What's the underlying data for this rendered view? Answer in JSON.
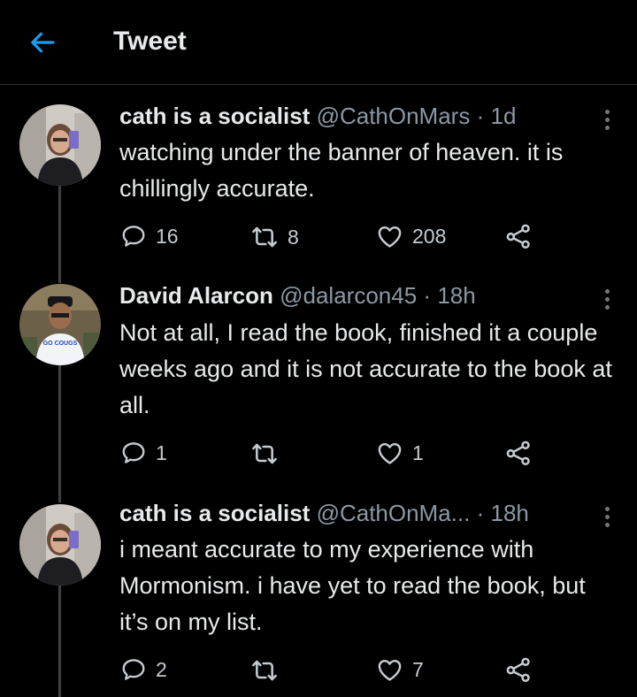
{
  "header": {
    "title": "Tweet",
    "back_icon": "arrow-left-icon",
    "accent": "#1d9bf0"
  },
  "tweets": [
    {
      "name": "cath is a socialist",
      "handle": "@CathOnMars",
      "time": "1d",
      "text": "watching under the banner of heaven. it is chillingly accurate.",
      "replies": "16",
      "retweets": "8",
      "likes": "208"
    },
    {
      "name": "David Alarcon",
      "handle": "@dalarcon45",
      "time": "18h",
      "text": "Not at all, I read the book, finished it a couple weeks ago and it is not accurate to the book at all.",
      "replies": "1",
      "retweets": "",
      "likes": "1",
      "shirt_text": "GO COUGS"
    },
    {
      "name": "cath is a socialist",
      "handle": "@CathOnMa...",
      "time": "18h",
      "text": "i meant accurate to my experience with Mormonism. i have yet to read the book, but it’s on my list.",
      "replies": "2",
      "retweets": "",
      "likes": "7"
    }
  ],
  "icons": [
    "reply-icon",
    "retweet-icon",
    "like-icon",
    "share-icon",
    "more-icon"
  ]
}
